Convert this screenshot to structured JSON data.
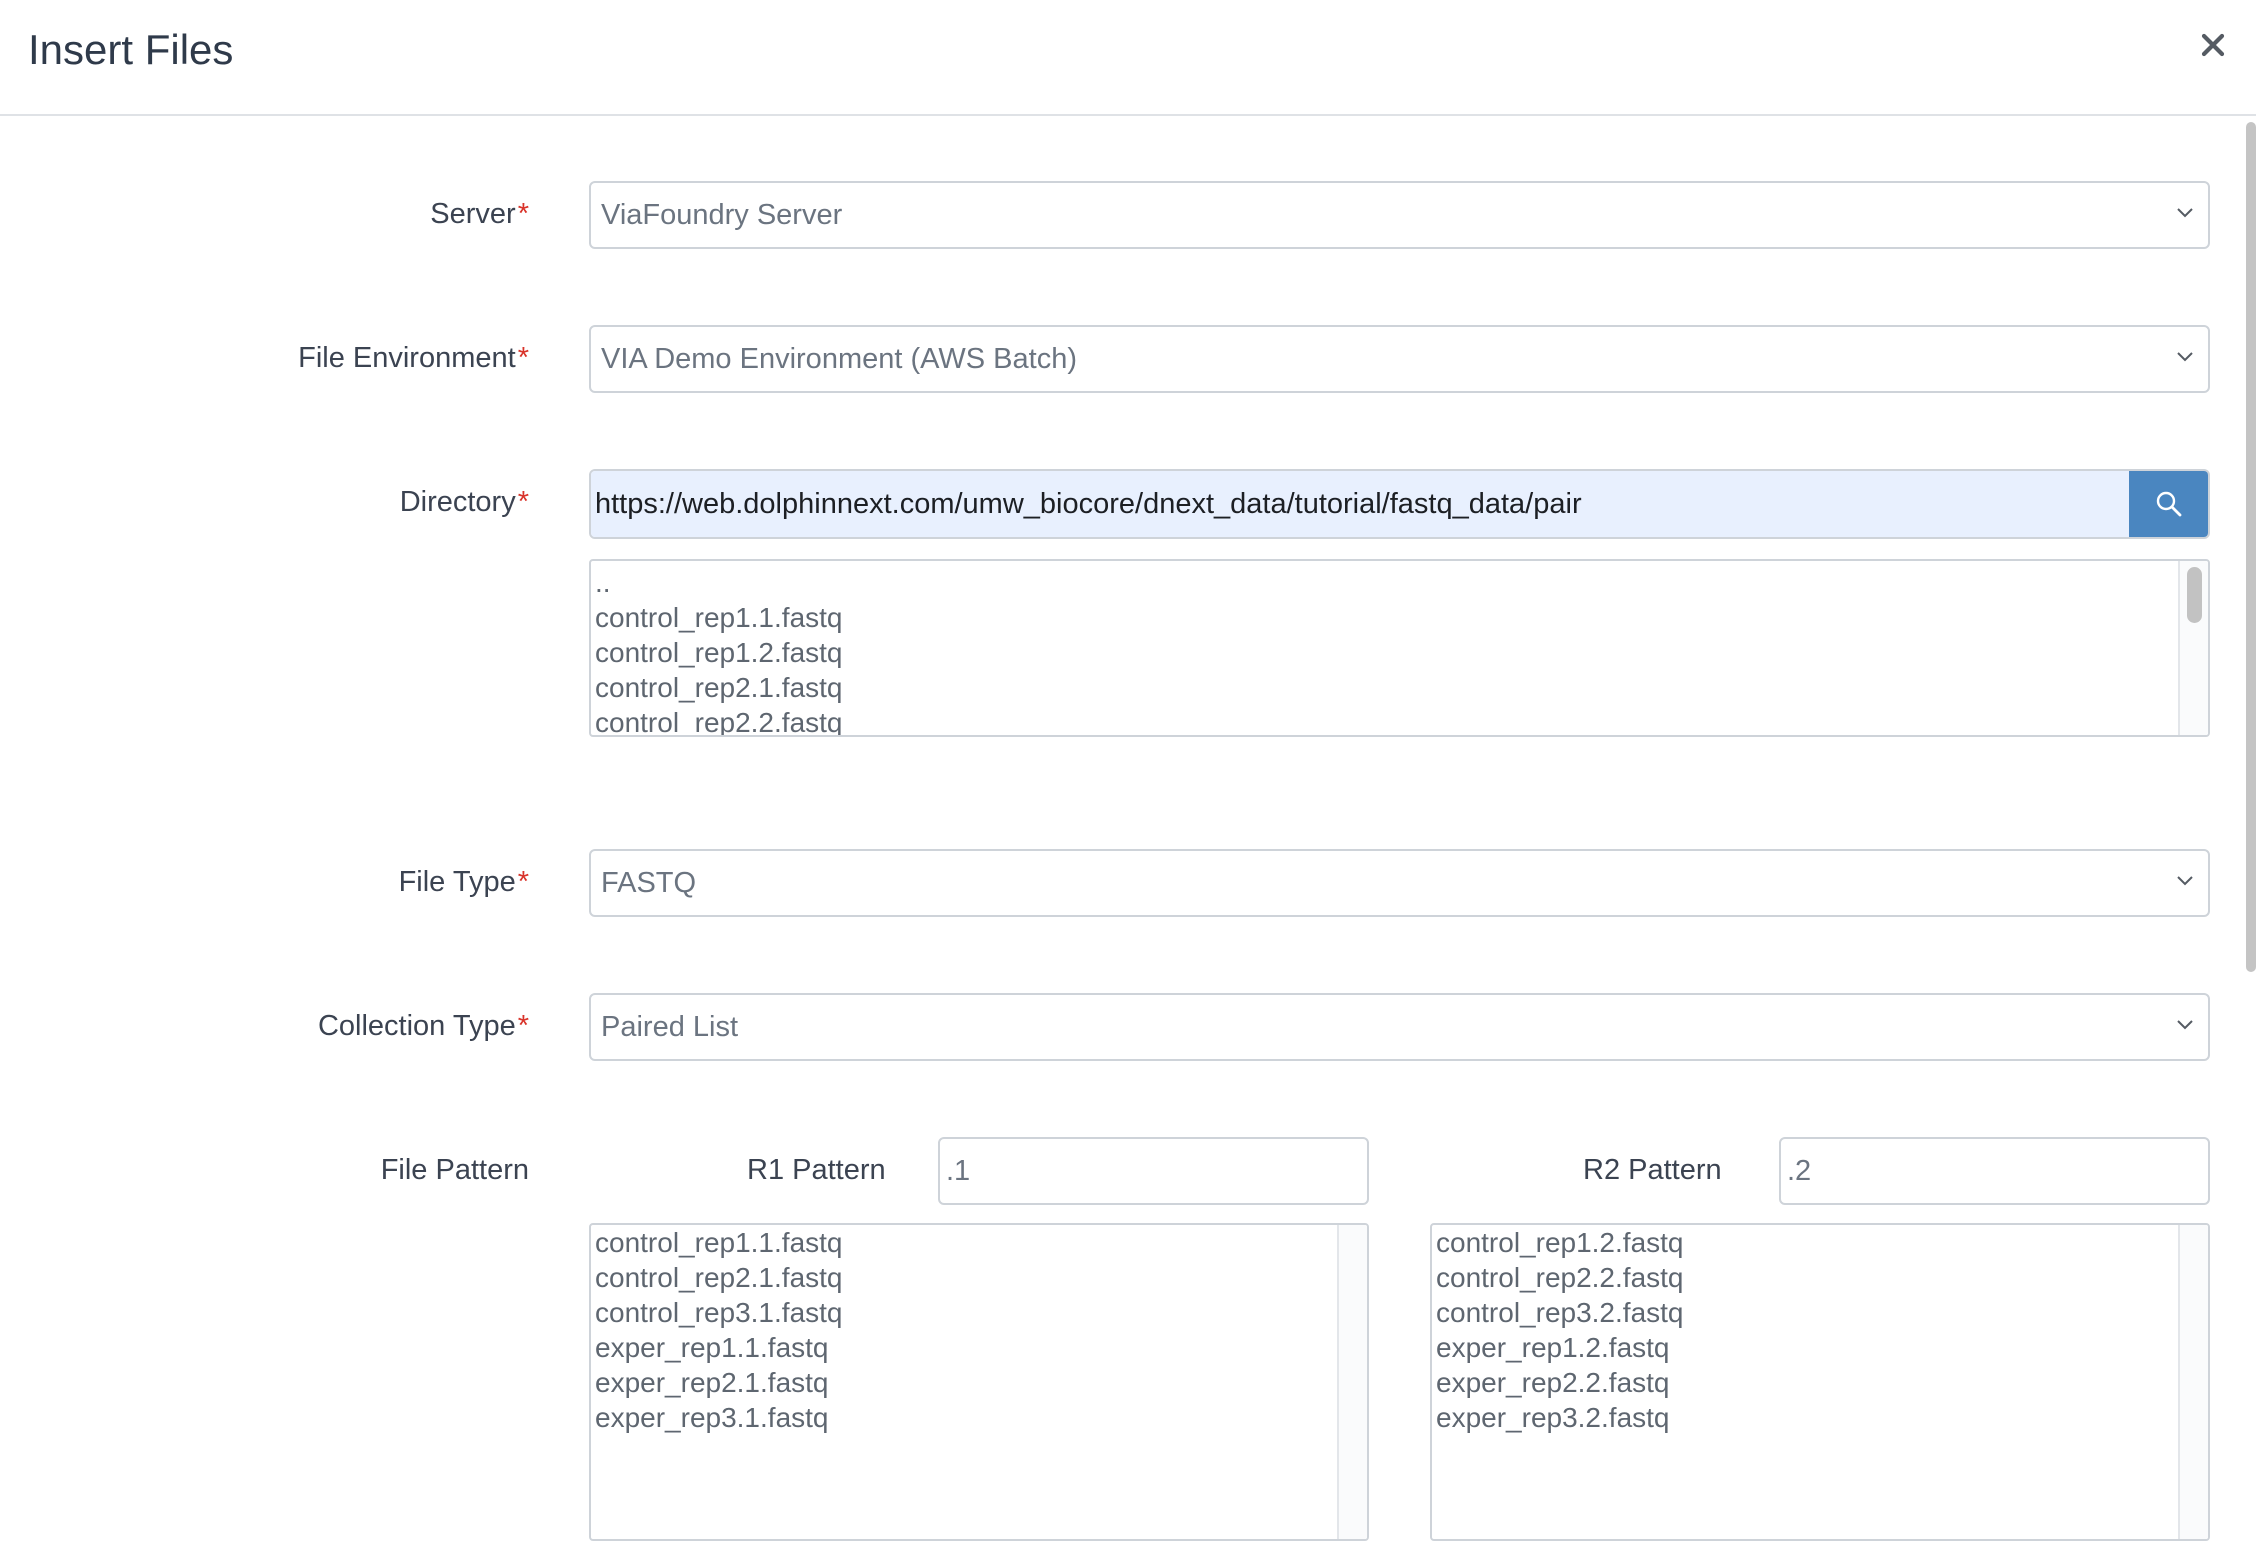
{
  "modal": {
    "title": "Insert Files",
    "close_label": "×"
  },
  "form": {
    "required_mark": "*",
    "server": {
      "label": "Server",
      "value": "ViaFoundry Server"
    },
    "file_environment": {
      "label": "File Environment",
      "value": "VIA Demo Environment (AWS Batch)"
    },
    "directory": {
      "label": "Directory",
      "value": "https://web.dolphinnext.com/umw_biocore/dnext_data/tutorial/fastq_data/pair",
      "files": [
        "..",
        "control_rep1.1.fastq",
        "control_rep1.2.fastq",
        "control_rep2.1.fastq",
        "control_rep2.2.fastq"
      ]
    },
    "file_type": {
      "label": "File Type",
      "value": "FASTQ"
    },
    "collection_type": {
      "label": "Collection Type",
      "value": "Paired List"
    },
    "file_pattern": {
      "label": "File Pattern",
      "r1": {
        "label": "R1 Pattern",
        "value": ".1",
        "files": [
          "control_rep1.1.fastq",
          "control_rep2.1.fastq",
          "control_rep3.1.fastq",
          "exper_rep1.1.fastq",
          "exper_rep2.1.fastq",
          "exper_rep3.1.fastq"
        ]
      },
      "r2": {
        "label": "R2 Pattern",
        "value": ".2",
        "files": [
          "control_rep1.2.fastq",
          "control_rep2.2.fastq",
          "control_rep3.2.fastq",
          "exper_rep1.2.fastq",
          "exper_rep2.2.fastq",
          "exper_rep3.2.fastq"
        ]
      }
    }
  },
  "icons": {
    "close": "close-icon",
    "dropdown": "chevron-down-icon",
    "search": "search-icon"
  },
  "colors": {
    "required": "#d9332a",
    "search_button": "#4a86c0",
    "autofill_bg": "#e8f0fe"
  }
}
